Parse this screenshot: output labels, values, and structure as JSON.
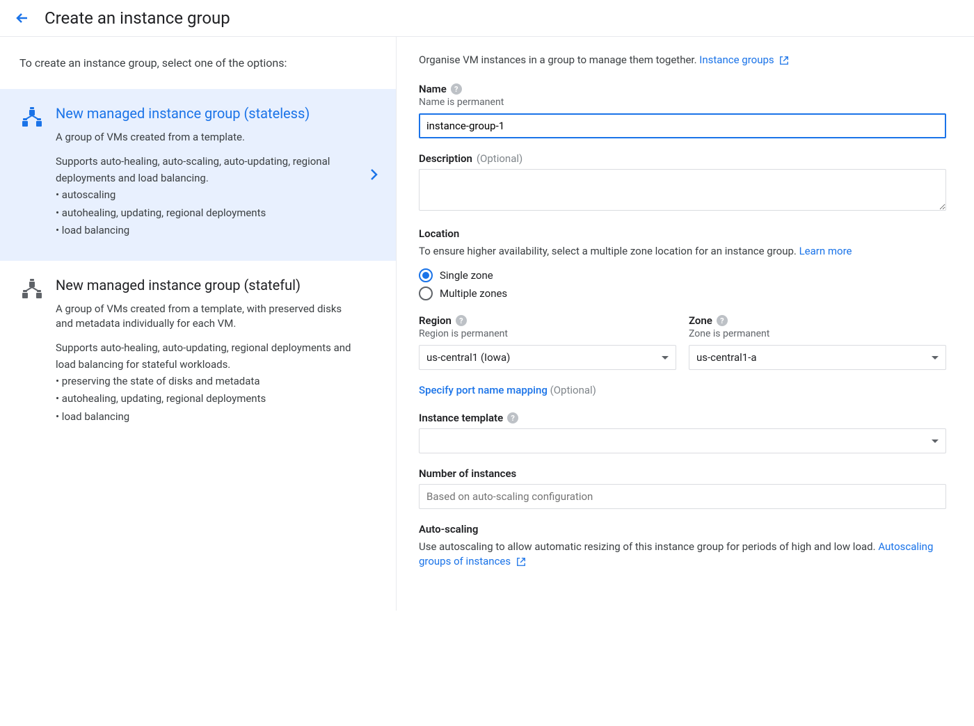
{
  "header": {
    "title": "Create an instance group"
  },
  "leftPanel": {
    "intro": "To create an instance group, select one of the options:",
    "options": [
      {
        "title": "New managed instance group (stateless)",
        "desc": "A group of VMs created from a template.",
        "supports": "Supports auto-healing, auto-scaling, auto-updating, regional deployments and load balancing.",
        "bullets": [
          "autoscaling",
          "autohealing, updating, regional deployments",
          "load balancing"
        ]
      },
      {
        "title": "New managed instance group (stateful)",
        "desc": "A group of VMs created from a template, with preserved disks and metadata individually for each VM.",
        "supports": "Supports auto-healing, auto-updating, regional deployments and load balancing for stateful workloads.",
        "bullets": [
          "preserving the state of disks and metadata",
          "autohealing, updating, regional deployments",
          "load balancing"
        ]
      }
    ]
  },
  "rightPanel": {
    "introText": "Organise VM instances in a group to manage them together.",
    "introLink": "Instance groups",
    "name": {
      "label": "Name",
      "sublabel": "Name is permanent",
      "value": "instance-group-1"
    },
    "description": {
      "label": "Description",
      "optional": "(Optional)"
    },
    "location": {
      "title": "Location",
      "desc": "To ensure higher availability, select a multiple zone location for an instance group.",
      "learnMore": "Learn more",
      "radios": {
        "single": "Single zone",
        "multiple": "Multiple zones"
      }
    },
    "region": {
      "label": "Region",
      "sublabel": "Region is permanent",
      "value": "us-central1 (Iowa)"
    },
    "zone": {
      "label": "Zone",
      "sublabel": "Zone is permanent",
      "value": "us-central1-a"
    },
    "portMapping": {
      "link": "Specify port name mapping",
      "optional": "(Optional)"
    },
    "instanceTemplate": {
      "label": "Instance template"
    },
    "numInstances": {
      "label": "Number of instances",
      "placeholder": "Based on auto-scaling configuration"
    },
    "autoScaling": {
      "title": "Auto-scaling",
      "desc": "Use autoscaling to allow automatic resizing of this instance group for periods of high and low load.",
      "link": "Autoscaling groups of instances"
    }
  }
}
